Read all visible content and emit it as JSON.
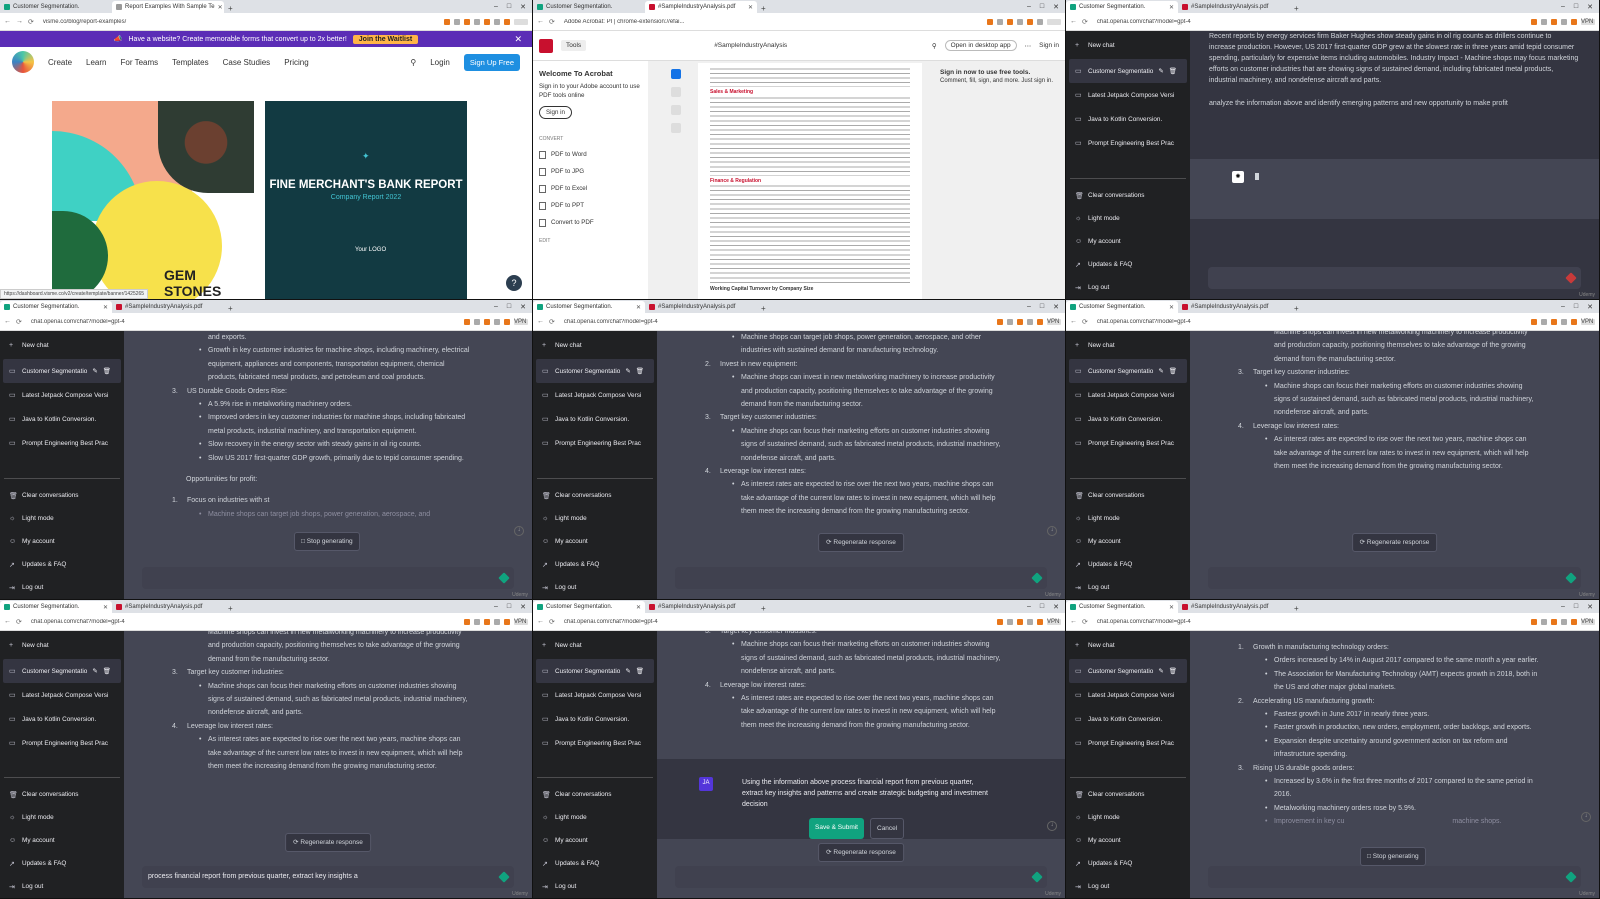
{
  "browser": {
    "tab_chat": "Customer Segmentation.",
    "tab_pdf": "#SampleIndustryAnalysis.pdf",
    "url_chat": "chat.openai.com/chat?model=gpt-4",
    "vpn": "VPN"
  },
  "visme": {
    "tab_active": "Report Examples With Sample Te",
    "url": "visme.co/blog/report-examples/",
    "banner_text": "Have a website? Create memorable forms that convert up to 2x better!",
    "banner_btn": "Join the Waitlist",
    "nav": [
      "Create",
      "Learn",
      "For Teams",
      "Templates",
      "Case Studies",
      "Pricing"
    ],
    "login": "Login",
    "signup": "Sign Up Free",
    "card1_title": "GEM STONES",
    "card2_title": "FINE MERCHANT'S BANK REPORT",
    "card2_sub": "Company Report 2022",
    "card2_logo": "Your LOGO",
    "status_url": "https://dashboard.visme.co/v2/create/template/banner/1425265"
  },
  "acrobat": {
    "tab": "#SampleIndustryAnalysis.pdf",
    "url": "Adobe Acrobat: PI | chrome-extension://efai...",
    "tools": "Tools",
    "doc": "#SampleIndustryAnalysis",
    "open_app": "Open in desktop app",
    "sign_in": "Sign in",
    "welcome": "Welcome To Acrobat",
    "welcome_text": "Sign in to your Adobe account to use PDF tools online",
    "sign_in_btn": "Sign in",
    "convert_label": "CONVERT",
    "options": [
      "PDF to Word",
      "PDF to JPG",
      "PDF to Excel",
      "PDF to PPT",
      "Convert to PDF"
    ],
    "edit_label": "EDIT",
    "page_head1": "Sales & Marketing",
    "page_head2": "Finance & Regulation",
    "page_head3": "Working Capital Turnover by Company Size",
    "signin_panel_title": "Sign in now to use free tools.",
    "signin_panel_text": "Comment, fill, sign, and more. Just sign in."
  },
  "sidebar": {
    "new_chat": "New chat",
    "conversations": [
      "Customer Segmentatio",
      "Latest Jetpack Compose Versi",
      "Java to Kotlin Conversion.",
      "Prompt Engineering Best Prac"
    ],
    "bottom": [
      "Clear conversations",
      "Light mode",
      "My account",
      "Updates & FAQ",
      "Log out"
    ]
  },
  "cell3": {
    "prompt": "Recent reports by energy services firm Baker Hughes show steady gains in oil rig counts as drillers continue to increase production. However, US 2017 first-quarter GDP grew at the slowest rate in three years amid tepid consumer spending, particularly for expensive items including automobiles. Industry Impact - Machine shops may focus marketing efforts on customer industries that are showing signs of sustained demand, including fabricated metal products, industrial machinery, and nondefense aircraft and parts.",
    "prompt2": "analyze the information above and identify emerging patterns and new opportunity to make profit"
  },
  "cell4": {
    "b1": "and exports.",
    "b2": "Growth in key customer industries for machine shops, including machinery, electrical equipment, appliances and components, transportation equipment, chemical products, fabricated metal products, and petroleum and coal products.",
    "n3": "3.",
    "h3": "US Durable Goods Orders Rise:",
    "b3": "A 5.9% rise in metalworking machinery orders.",
    "b4": "Improved orders in key customer industries for machine shops, including fabricated metal products, industrial machinery, and transportation equipment.",
    "b5": "Slow recovery in the energy sector with steady gains in oil rig counts.",
    "b6": "Slow US 2017 first-quarter GDP growth, primarily due to tepid consumer spending.",
    "opp": "Opportunities for profit:",
    "n1": "1.",
    "h1": "Focus on industries with st",
    "faded": "Machine shops can target job shops, power generation, aerospace, and",
    "stop": "Stop generating"
  },
  "cell5": {
    "t1": "Machine shops can target job shops, power generation, aerospace, and other industries with sustained demand for manufacturing technology.",
    "n2": "2.",
    "h2": "Invest in new equipment:",
    "t2": "Machine shops can invest in new metalworking machinery to increase productivity and production capacity, positioning themselves to take advantage of the growing demand from the manufacturing sector.",
    "n3": "3.",
    "h3": "Target key customer industries:",
    "t3": "Machine shops can focus their marketing efforts on customer industries showing signs of sustained demand, such as fabricated metal products, industrial machinery, nondefense aircraft, and parts.",
    "n4": "4.",
    "h4": "Leverage low interest rates:",
    "t4": "As interest rates are expected to rise over the next two years, machine shops can take advantage of the current low rates to invest in new equipment, which will help them meet the increasing demand from the growing manufacturing sector.",
    "regen": "Regenerate response"
  },
  "cell7": {
    "composer": "process financial report from previous quarter, extract key insights a"
  },
  "cell8": {
    "avatar": "JA",
    "edit_text": "Using the information above process financial report from previous quarter, extract key insights and patterns and create strategic budgeting and investment decision",
    "save": "Save & Submit",
    "cancel": "Cancel"
  },
  "cell9": {
    "n1": "1.",
    "h1": "Growth in manufacturing technology orders:",
    "a1": "Orders increased by 14% in August 2017 compared to the same month a year earlier.",
    "a2": "The Association for Manufacturing Technology (AMT) expects growth in 2018, both in the US and other major global markets.",
    "n2": "2.",
    "h2": "Accelerating US manufacturing growth:",
    "b1": "Fastest growth in June 2017 in nearly three years.",
    "b2": "Faster growth in production, new orders, employment, order backlogs, and exports.",
    "b3": "Expansion despite uncertainty around government action on tax reform and infrastructure spending.",
    "n3": "3.",
    "h3": "Rising US durable goods orders:",
    "c1": "Increased by 3.6% in the first three months of 2017 compared to the same period in 2016.",
    "c2": "Metalworking machinery orders rose by 5.9%.",
    "c3a": "Improvement in key cu",
    "c3b": "machine shops.",
    "stop": "Stop generating"
  },
  "watermark": "Udemy"
}
